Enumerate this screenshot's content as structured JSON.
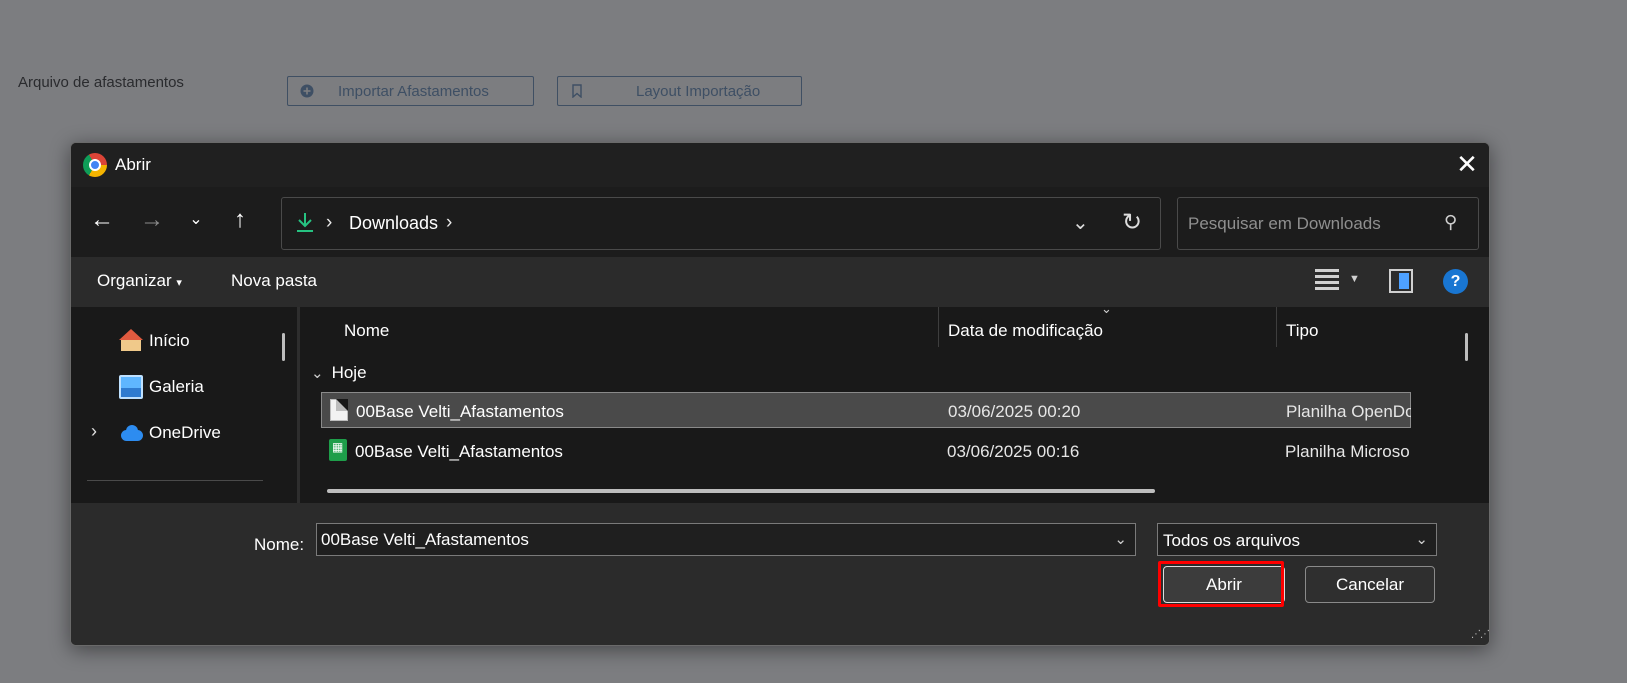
{
  "background_page": {
    "label": "Arquivo de afastamentos",
    "import_button": "Importar Afastamentos",
    "layout_button": "Layout Importação"
  },
  "dialog": {
    "title": "Abrir",
    "address": {
      "location": "Downloads",
      "separator": "›"
    },
    "search": {
      "placeholder": "Pesquisar em Downloads"
    },
    "toolbar": {
      "organize": "Organizar",
      "new_folder": "Nova pasta"
    },
    "nav_pane": {
      "items": [
        {
          "label": "Início",
          "icon": "home-icon"
        },
        {
          "label": "Galeria",
          "icon": "gallery-icon"
        },
        {
          "label": "OneDrive",
          "icon": "onedrive-icon",
          "expandable": true
        }
      ]
    },
    "file_list": {
      "columns": [
        "Nome",
        "Data de modificação",
        "Tipo"
      ],
      "group": "Hoje",
      "rows": [
        {
          "name": "00Base Velti_Afastamentos",
          "date": "03/06/2025 00:20",
          "type": "Planilha OpenDo",
          "icon": "ods-file-icon",
          "selected": true
        },
        {
          "name": "00Base Velti_Afastamentos",
          "date": "03/06/2025 00:16",
          "type": "Planilha Microso",
          "icon": "xlsx-file-icon",
          "selected": false
        }
      ]
    },
    "footer": {
      "name_label": "Nome:",
      "name_value": "00Base Velti_Afastamentos",
      "file_type": "Todos os arquivos",
      "open_button": "Abrir",
      "cancel_button": "Cancelar"
    }
  },
  "colors": {
    "accent": "#26c281",
    "highlight": "#ff0000",
    "help_blue": "#1976d2"
  }
}
